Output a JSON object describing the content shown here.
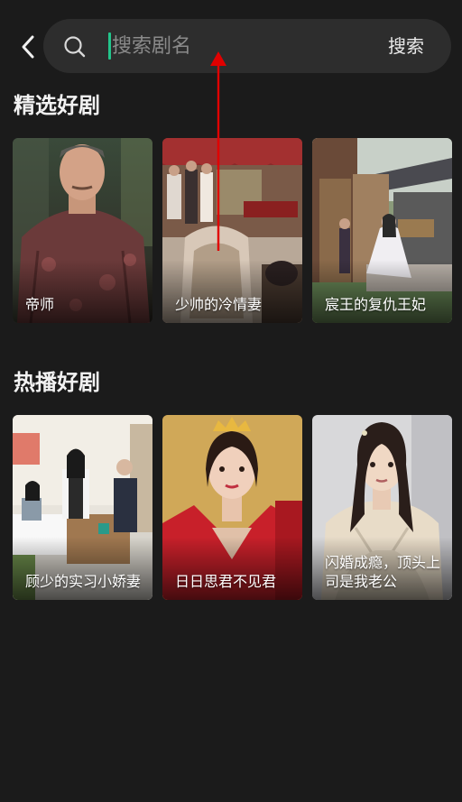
{
  "search": {
    "placeholder": "搜索剧名",
    "button_label": "搜索"
  },
  "sections": [
    {
      "title": "精选好剧",
      "items": [
        {
          "title": "帝师"
        },
        {
          "title": "少帅的冷情妻"
        },
        {
          "title": "宸王的复仇王妃"
        }
      ]
    },
    {
      "title": "热播好剧",
      "items": [
        {
          "title": "顾少的实习小娇妻"
        },
        {
          "title": "日日思君不见君"
        },
        {
          "title": "闪婚成瘾，顶头上司是我老公"
        }
      ]
    }
  ],
  "colors": {
    "background": "#1b1b1b",
    "search_bar": "#2d2d2d",
    "caret": "#22c58b",
    "swipe_arrow": "#e00000"
  },
  "icons": [
    "back-arrow-icon",
    "search-icon",
    "swipe-up-arrow-icon"
  ]
}
